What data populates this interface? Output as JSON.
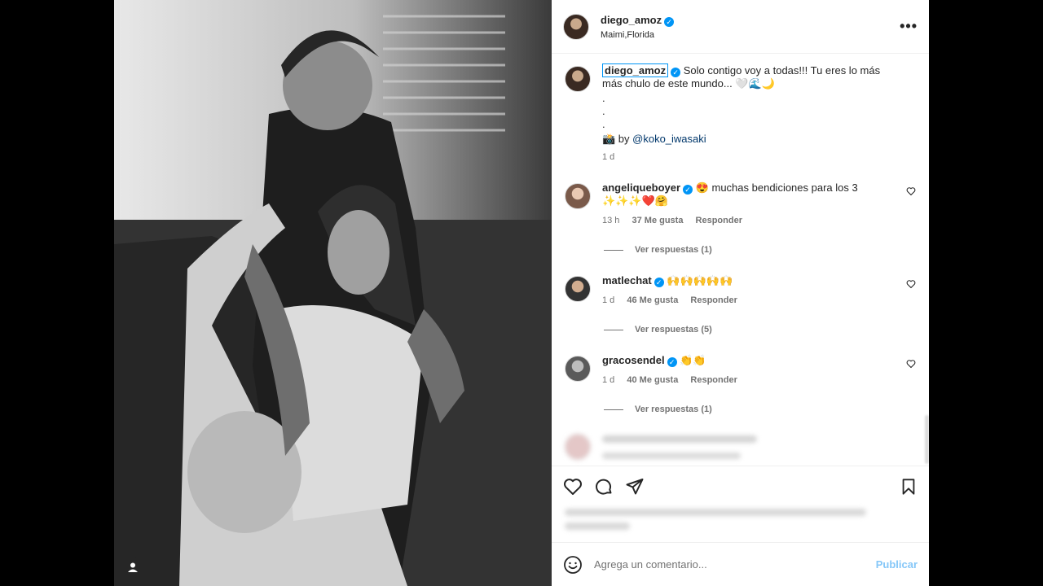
{
  "post": {
    "author": {
      "username": "diego_amoz",
      "location": "Maimi,Florida",
      "verified": true
    },
    "caption": {
      "username": "diego_amoz",
      "text": "Solo contigo voy a todas!!! Tu eres lo más más chulo de este mundo... 🤍🌊🌙",
      "dots": [
        ".",
        ".",
        "."
      ],
      "credit_prefix": "📸 by ",
      "credit_mention": "@koko_iwasaki",
      "time": "1 d"
    },
    "comments": [
      {
        "username": "angeliqueboyer",
        "text": "😍 muchas bendiciones para los 3 ✨✨✨❤️🤗",
        "time": "13 h",
        "likes": "37 Me gusta",
        "reply": "Responder",
        "view_replies": "Ver respuestas (1)"
      },
      {
        "username": "matlechat",
        "text": "🙌🙌🙌🙌🙌",
        "time": "1 d",
        "likes": "46 Me gusta",
        "reply": "Responder",
        "view_replies": "Ver respuestas (5)"
      },
      {
        "username": "gracosendel",
        "text": "👏👏",
        "time": "1 d",
        "likes": "40 Me gusta",
        "reply": "Responder",
        "view_replies": "Ver respuestas (1)"
      }
    ],
    "add_comment": {
      "placeholder": "Agrega un comentario...",
      "publish": "Publicar"
    }
  },
  "icons": {
    "more": "more-options-icon",
    "like": "heart-icon",
    "comment": "comment-icon",
    "share": "share-icon",
    "save": "bookmark-icon",
    "emoji": "emoji-icon",
    "user_tag": "user-tag-icon"
  },
  "colors": {
    "verified": "#0095f6",
    "mention": "#00376b",
    "publish": "#85c7f8"
  }
}
